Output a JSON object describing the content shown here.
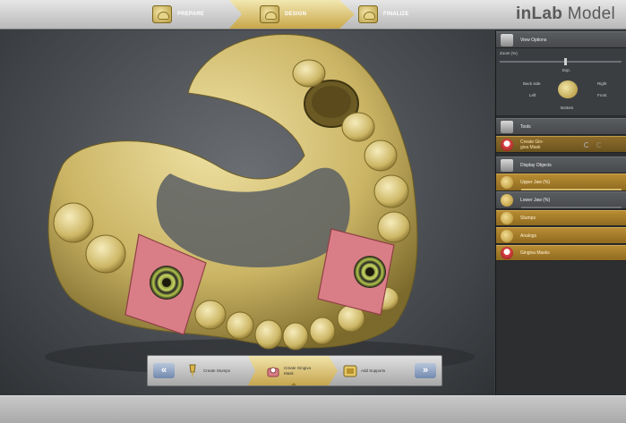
{
  "app": {
    "brand_prefix": "inLab",
    "brand_suffix": " Model"
  },
  "phases": [
    {
      "label": "PREPARE",
      "active": false
    },
    {
      "label": "DESIGN",
      "active": true
    },
    {
      "label": "FINALIZE",
      "active": false
    }
  ],
  "panel": {
    "view_options": "View Options",
    "zoom_label": "Zoom (%)",
    "zoom_value": "Exp.",
    "views": {
      "back_side": "Back side",
      "right": "Right",
      "left": "Left",
      "front": "Front",
      "bottom": "Bottom"
    },
    "tools": "Tools",
    "tool_item": "Create Gin-\ngiva Mask",
    "display_objects": "Display Objects",
    "upper_jaw": "Upper Jaw (%)",
    "lower_jaw": "Lower Jaw (%)",
    "stumps": "Stumps",
    "analogs": "Analogs",
    "gingiva_masks": "Gingiva Masks"
  },
  "steps": [
    {
      "label": "Create Stumps",
      "active": false
    },
    {
      "label": "Create Gingiva\nMask",
      "active": true
    },
    {
      "label": "Add Supports",
      "active": false
    }
  ],
  "nav": {
    "prev": "«",
    "next": "»"
  },
  "colors": {
    "accent_gold": "#c6a54e",
    "gingiva": "#d97e86",
    "model": "#d8c67a"
  }
}
